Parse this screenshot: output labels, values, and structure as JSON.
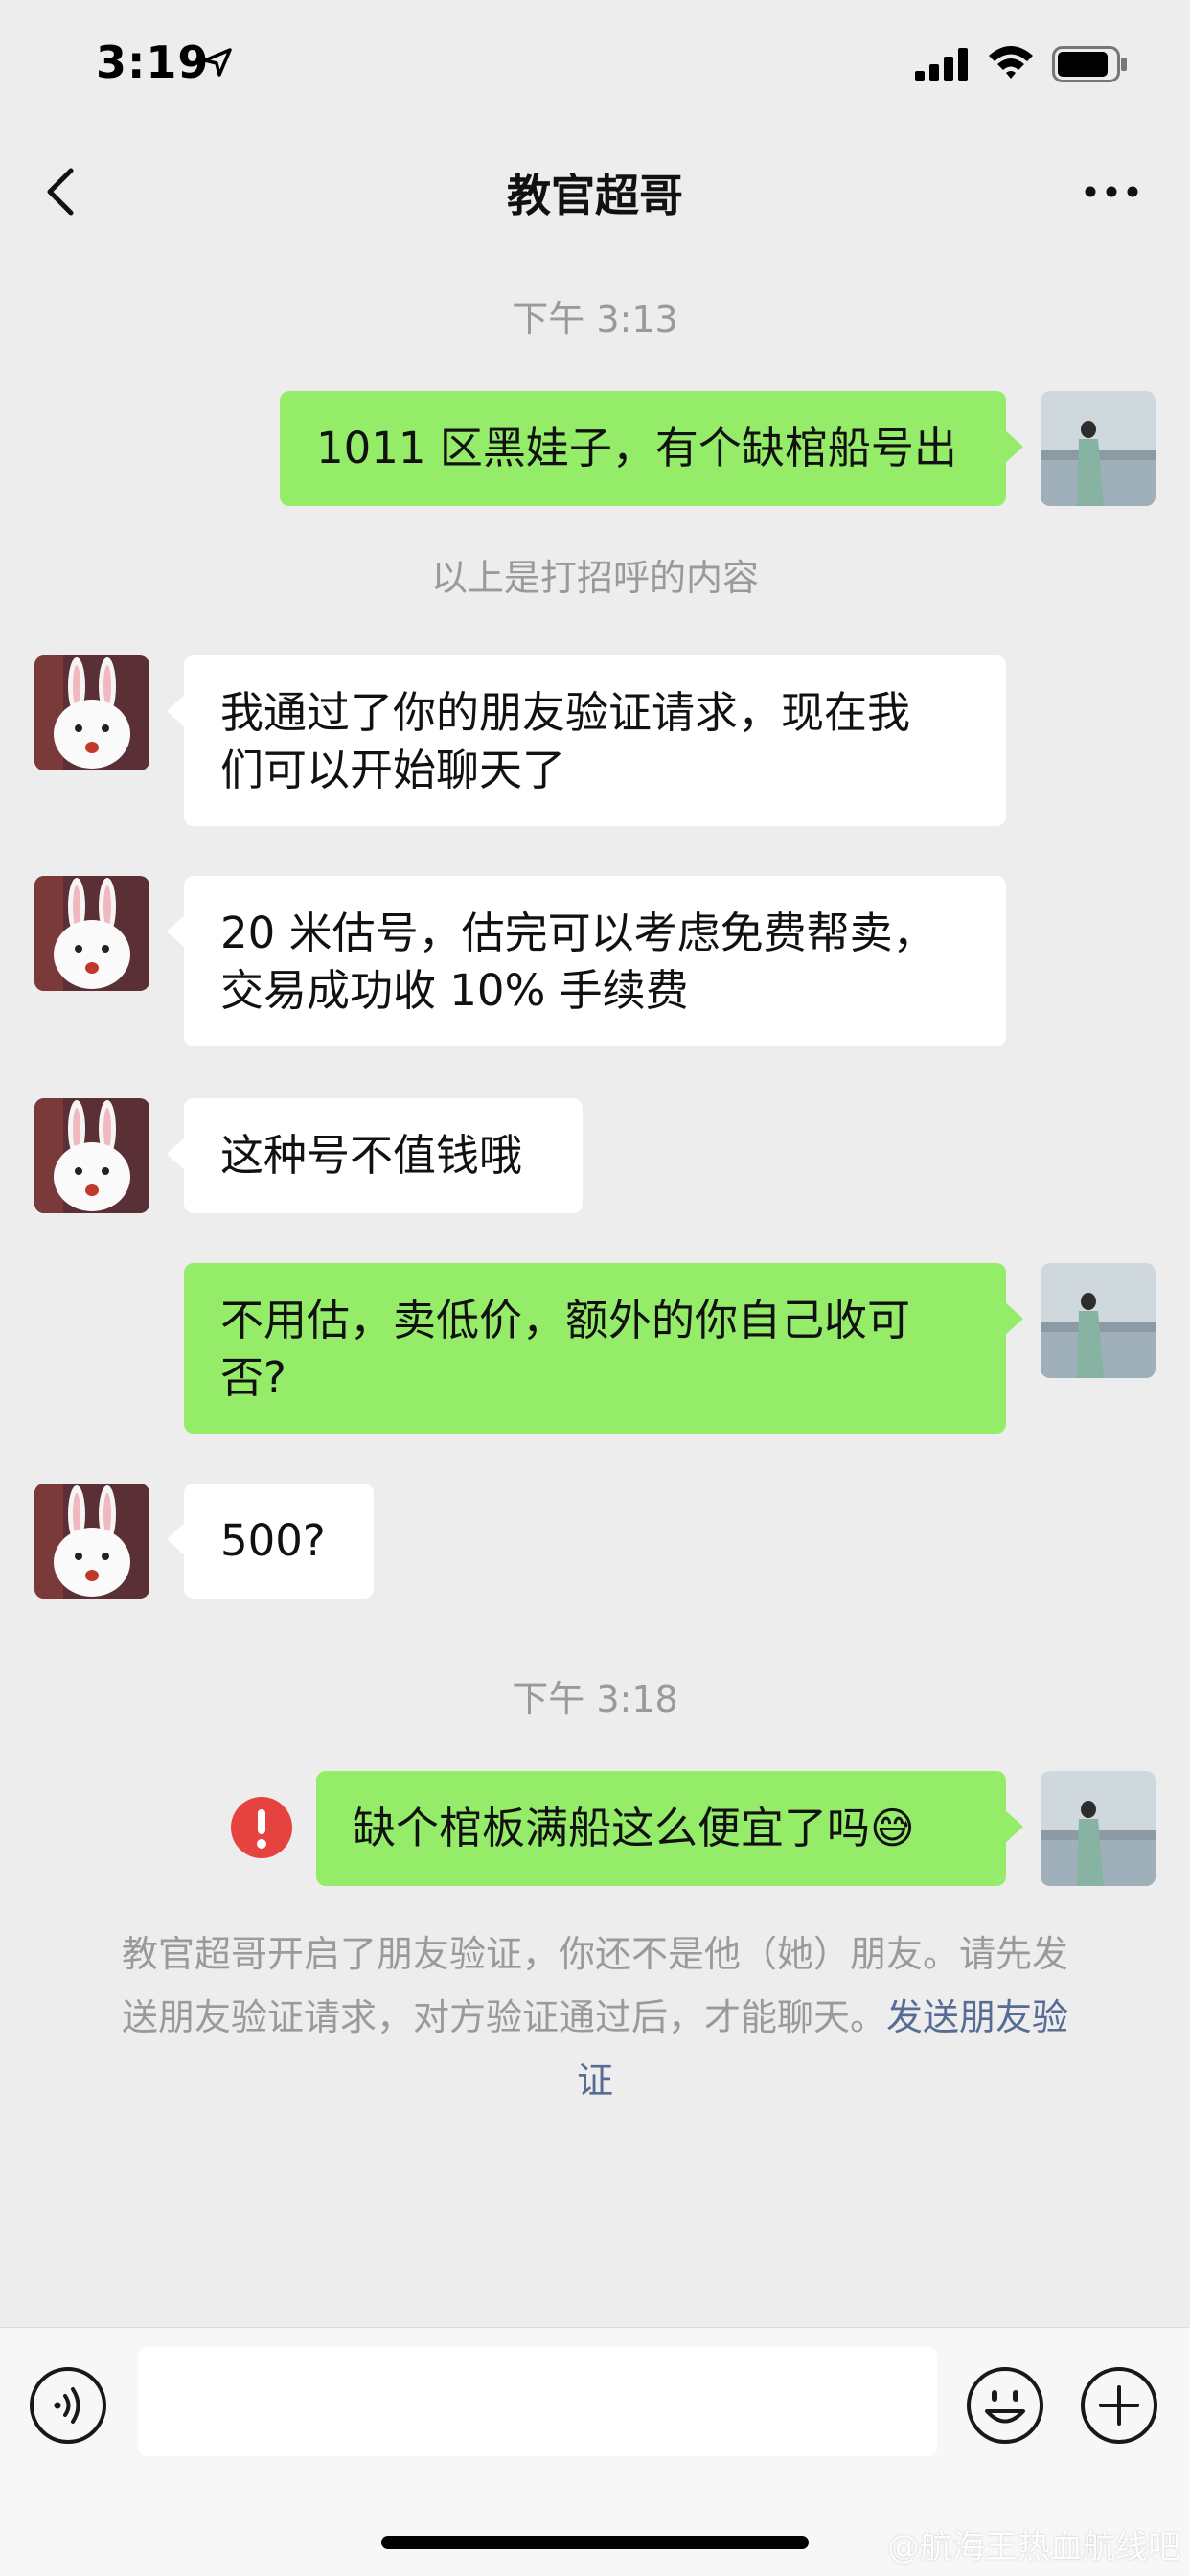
{
  "status_bar": {
    "time": "3:19"
  },
  "nav": {
    "title": "教官超哥"
  },
  "chat": {
    "time_1": "下午 3:13",
    "msg_1": "1011 区黑娃子，有个缺棺船号出",
    "system_greeting": "以上是打招呼的内容",
    "msg_2_lines": [
      "我通过了你的朋友验证请求，现在我",
      "们可以开始聊天了"
    ],
    "msg_3_lines": [
      "20 米估号，估完可以考虑免费帮卖，",
      "交易成功收 10% 手续费"
    ],
    "msg_4": "这种号不值钱哦",
    "msg_5_lines": [
      "不用估，卖低价，额外的你自己收可",
      "否?"
    ],
    "msg_6": "500?",
    "time_2": "下午 3:18",
    "msg_7": "缺个棺板满船这么便宜了吗",
    "msg_7_emoji": "😅",
    "notice_line_1": "教官超哥开启了朋友验证，你还不是他（她）朋友。请先发",
    "notice_line_2": "送朋友验证请求，对方验证通过后，才能聊天。",
    "notice_link_1": "发送朋友验",
    "notice_link_2": "证"
  },
  "watermark": "@航海王热血航线吧",
  "icons": {
    "back": "chevron-left-icon",
    "more": "more-icon",
    "voice": "voice-icon",
    "emoji": "emoji-icon",
    "plus": "plus-icon",
    "error": "error-icon"
  },
  "colors": {
    "sent_bubble": "#95ec69",
    "recv_bubble": "#ffffff",
    "background": "#ededed",
    "link": "#576b95",
    "error": "#e64340"
  }
}
